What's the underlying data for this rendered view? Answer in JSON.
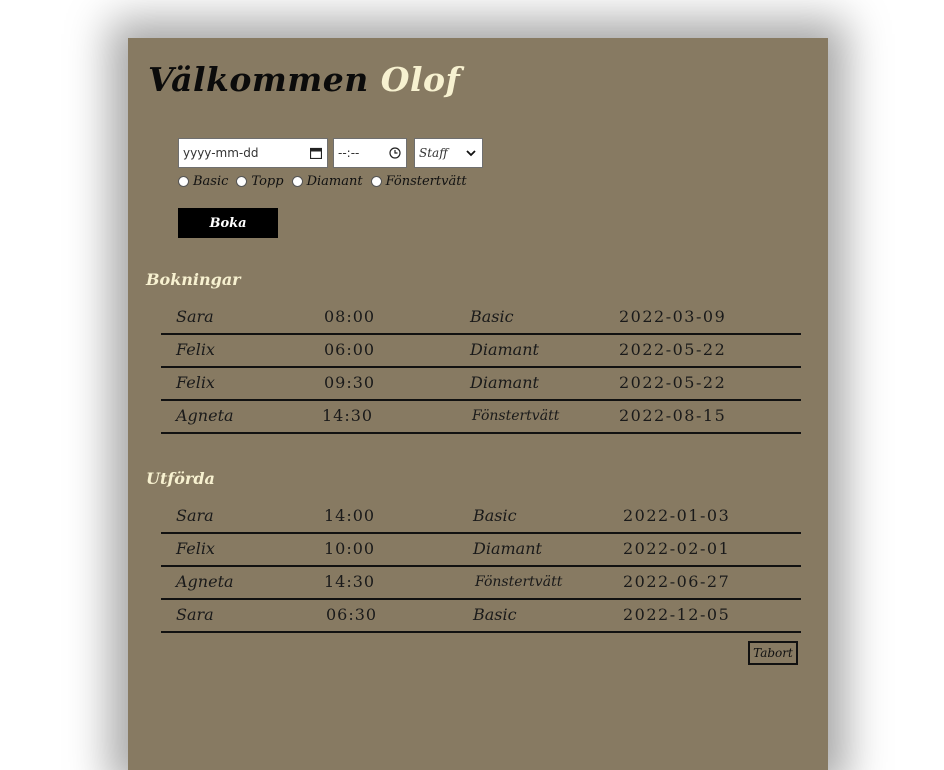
{
  "header": {
    "greeting": "Välkommen",
    "user_name": "Olof"
  },
  "form": {
    "date_placeholder": "yyyy-mm-dd",
    "time_placeholder": "--:--",
    "staff_selected": "Staff",
    "services": [
      "Basic",
      "Topp",
      "Diamant",
      "Fönstertvätt"
    ],
    "book_label": "Boka"
  },
  "bookings": {
    "title": "Bokningar",
    "rows": [
      {
        "name": "Sara",
        "time": "08:00",
        "service": "Basic",
        "date": "2022-03-09"
      },
      {
        "name": "Felix",
        "time": "06:00",
        "service": "Diamant",
        "date": "2022-05-22"
      },
      {
        "name": "Felix",
        "time": "09:30",
        "service": "Diamant",
        "date": "2022-05-22"
      },
      {
        "name": "Agneta",
        "time": "14:30",
        "service": "Fönstertvätt",
        "date": "2022-08-15"
      }
    ]
  },
  "completed": {
    "title": "Utförda",
    "rows": [
      {
        "name": "Sara",
        "time": "14:00",
        "service": "Basic",
        "date": "2022-01-03"
      },
      {
        "name": "Felix",
        "time": "10:00",
        "service": "Diamant",
        "date": "2022-02-01"
      },
      {
        "name": "Agneta",
        "time": "14:30",
        "service": "Fönstertvätt",
        "date": "2022-06-27"
      },
      {
        "name": "Sara",
        "time": "06:30",
        "service": "Basic",
        "date": "2022-12-05"
      }
    ],
    "remove_label": "Tabort"
  },
  "icons": {
    "date": "calendar-icon",
    "time": "clock-icon",
    "select": "chevron-down-icon"
  },
  "colors": {
    "panel": "#877a62",
    "accent_text": "#f7f1d0",
    "button": "#000000"
  }
}
